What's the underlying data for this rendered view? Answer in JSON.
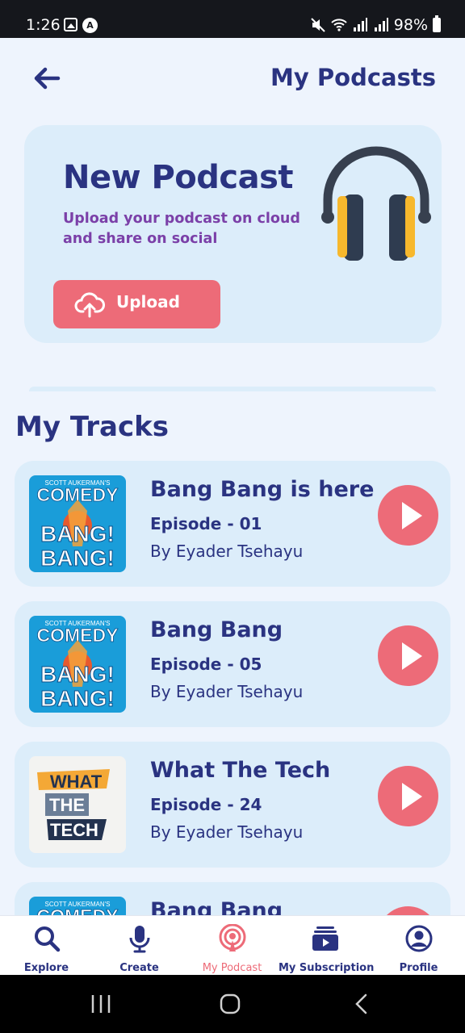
{
  "status_bar": {
    "time": "1:26",
    "battery": "98%"
  },
  "header": {
    "title": "My Podcasts"
  },
  "hero": {
    "title": "New Podcast",
    "subtitle": "Upload your podcast on cloud and share on social",
    "upload_label": "Upload"
  },
  "tracks_section": {
    "title": "My Tracks",
    "items": [
      {
        "title": "Bang Bang is here",
        "episode": "Episode - 01",
        "author": "By Eyader Tsehayu",
        "cover": "comedy-bang-bang"
      },
      {
        "title": "Bang Bang",
        "episode": "Episode - 05",
        "author": "By Eyader Tsehayu",
        "cover": "comedy-bang-bang"
      },
      {
        "title": "What The Tech",
        "episode": "Episode - 24",
        "author": "By Eyader Tsehayu",
        "cover": "what-the-tech"
      },
      {
        "title": "Bang Bang",
        "episode": "",
        "author": "",
        "cover": "comedy-bang-bang"
      }
    ]
  },
  "covers": {
    "comedy": {
      "top": "SCOTT AUKERMAN'S",
      "main": "COMEDY",
      "line1": "BANG!",
      "line2": "BANG!"
    },
    "tech": {
      "w1": "WHAT",
      "w2": "THE",
      "w3": "TECH"
    }
  },
  "bottom_nav": [
    {
      "label": "Explore",
      "icon": "search-icon"
    },
    {
      "label": "Create",
      "icon": "microphone-icon"
    },
    {
      "label": "My Podcast",
      "icon": "podcast-icon",
      "active": true
    },
    {
      "label": "My Subscription",
      "icon": "subscription-icon"
    },
    {
      "label": "Profile",
      "icon": "profile-icon"
    }
  ],
  "colors": {
    "primary": "#2a3381",
    "accent": "#ed6b78",
    "card": "#dcedfa",
    "subtitle": "#7b40a8",
    "background": "#eef4fd"
  }
}
